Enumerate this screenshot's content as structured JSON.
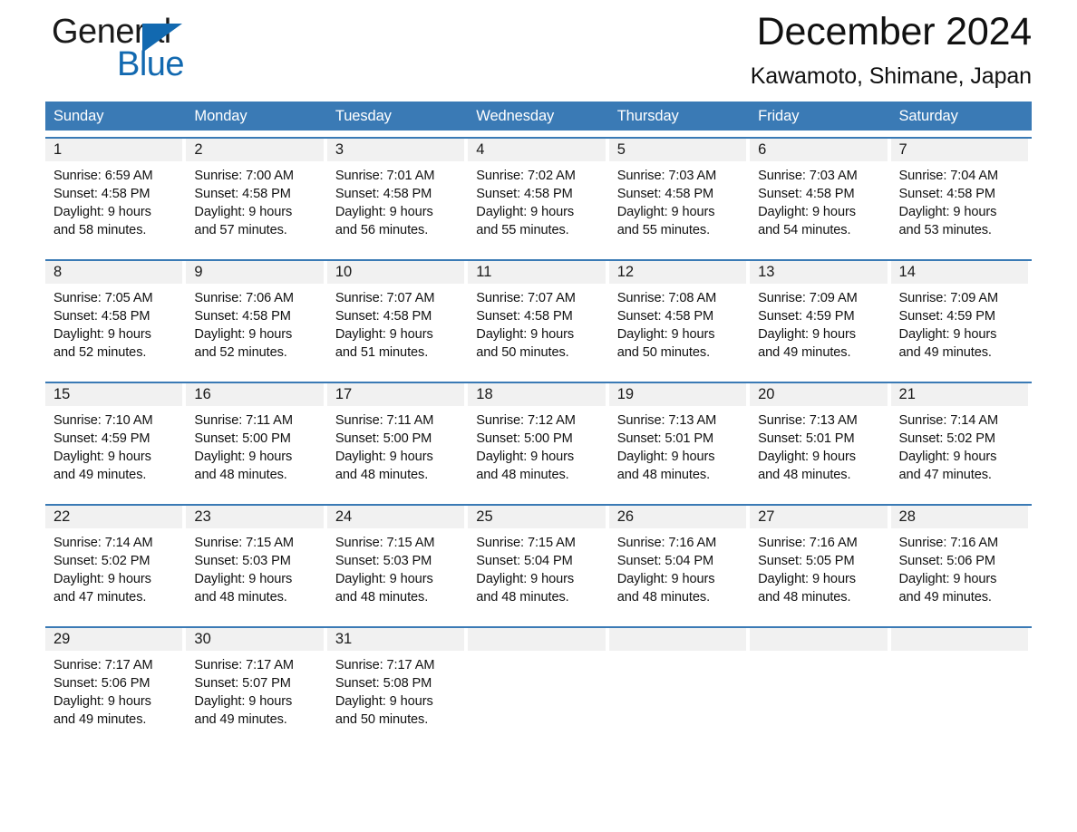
{
  "brand": {
    "word_one": "General",
    "word_two": "Blue",
    "triangle_icon": "triangle-icon",
    "accent_color": "#1269b0"
  },
  "header": {
    "title": "December 2024",
    "location": "Kawamoto, Shimane, Japan"
  },
  "theme": {
    "header_blue": "#3a7ab5",
    "daynum_strip": "#f1f1f1",
    "text": "#111111"
  },
  "weekdays": [
    "Sunday",
    "Monday",
    "Tuesday",
    "Wednesday",
    "Thursday",
    "Friday",
    "Saturday"
  ],
  "weeks": [
    [
      {
        "day": "1",
        "sunrise": "Sunrise: 6:59 AM",
        "sunset": "Sunset: 4:58 PM",
        "daylight1": "Daylight: 9 hours",
        "daylight2": "and 58 minutes."
      },
      {
        "day": "2",
        "sunrise": "Sunrise: 7:00 AM",
        "sunset": "Sunset: 4:58 PM",
        "daylight1": "Daylight: 9 hours",
        "daylight2": "and 57 minutes."
      },
      {
        "day": "3",
        "sunrise": "Sunrise: 7:01 AM",
        "sunset": "Sunset: 4:58 PM",
        "daylight1": "Daylight: 9 hours",
        "daylight2": "and 56 minutes."
      },
      {
        "day": "4",
        "sunrise": "Sunrise: 7:02 AM",
        "sunset": "Sunset: 4:58 PM",
        "daylight1": "Daylight: 9 hours",
        "daylight2": "and 55 minutes."
      },
      {
        "day": "5",
        "sunrise": "Sunrise: 7:03 AM",
        "sunset": "Sunset: 4:58 PM",
        "daylight1": "Daylight: 9 hours",
        "daylight2": "and 55 minutes."
      },
      {
        "day": "6",
        "sunrise": "Sunrise: 7:03 AM",
        "sunset": "Sunset: 4:58 PM",
        "daylight1": "Daylight: 9 hours",
        "daylight2": "and 54 minutes."
      },
      {
        "day": "7",
        "sunrise": "Sunrise: 7:04 AM",
        "sunset": "Sunset: 4:58 PM",
        "daylight1": "Daylight: 9 hours",
        "daylight2": "and 53 minutes."
      }
    ],
    [
      {
        "day": "8",
        "sunrise": "Sunrise: 7:05 AM",
        "sunset": "Sunset: 4:58 PM",
        "daylight1": "Daylight: 9 hours",
        "daylight2": "and 52 minutes."
      },
      {
        "day": "9",
        "sunrise": "Sunrise: 7:06 AM",
        "sunset": "Sunset: 4:58 PM",
        "daylight1": "Daylight: 9 hours",
        "daylight2": "and 52 minutes."
      },
      {
        "day": "10",
        "sunrise": "Sunrise: 7:07 AM",
        "sunset": "Sunset: 4:58 PM",
        "daylight1": "Daylight: 9 hours",
        "daylight2": "and 51 minutes."
      },
      {
        "day": "11",
        "sunrise": "Sunrise: 7:07 AM",
        "sunset": "Sunset: 4:58 PM",
        "daylight1": "Daylight: 9 hours",
        "daylight2": "and 50 minutes."
      },
      {
        "day": "12",
        "sunrise": "Sunrise: 7:08 AM",
        "sunset": "Sunset: 4:58 PM",
        "daylight1": "Daylight: 9 hours",
        "daylight2": "and 50 minutes."
      },
      {
        "day": "13",
        "sunrise": "Sunrise: 7:09 AM",
        "sunset": "Sunset: 4:59 PM",
        "daylight1": "Daylight: 9 hours",
        "daylight2": "and 49 minutes."
      },
      {
        "day": "14",
        "sunrise": "Sunrise: 7:09 AM",
        "sunset": "Sunset: 4:59 PM",
        "daylight1": "Daylight: 9 hours",
        "daylight2": "and 49 minutes."
      }
    ],
    [
      {
        "day": "15",
        "sunrise": "Sunrise: 7:10 AM",
        "sunset": "Sunset: 4:59 PM",
        "daylight1": "Daylight: 9 hours",
        "daylight2": "and 49 minutes."
      },
      {
        "day": "16",
        "sunrise": "Sunrise: 7:11 AM",
        "sunset": "Sunset: 5:00 PM",
        "daylight1": "Daylight: 9 hours",
        "daylight2": "and 48 minutes."
      },
      {
        "day": "17",
        "sunrise": "Sunrise: 7:11 AM",
        "sunset": "Sunset: 5:00 PM",
        "daylight1": "Daylight: 9 hours",
        "daylight2": "and 48 minutes."
      },
      {
        "day": "18",
        "sunrise": "Sunrise: 7:12 AM",
        "sunset": "Sunset: 5:00 PM",
        "daylight1": "Daylight: 9 hours",
        "daylight2": "and 48 minutes."
      },
      {
        "day": "19",
        "sunrise": "Sunrise: 7:13 AM",
        "sunset": "Sunset: 5:01 PM",
        "daylight1": "Daylight: 9 hours",
        "daylight2": "and 48 minutes."
      },
      {
        "day": "20",
        "sunrise": "Sunrise: 7:13 AM",
        "sunset": "Sunset: 5:01 PM",
        "daylight1": "Daylight: 9 hours",
        "daylight2": "and 48 minutes."
      },
      {
        "day": "21",
        "sunrise": "Sunrise: 7:14 AM",
        "sunset": "Sunset: 5:02 PM",
        "daylight1": "Daylight: 9 hours",
        "daylight2": "and 47 minutes."
      }
    ],
    [
      {
        "day": "22",
        "sunrise": "Sunrise: 7:14 AM",
        "sunset": "Sunset: 5:02 PM",
        "daylight1": "Daylight: 9 hours",
        "daylight2": "and 47 minutes."
      },
      {
        "day": "23",
        "sunrise": "Sunrise: 7:15 AM",
        "sunset": "Sunset: 5:03 PM",
        "daylight1": "Daylight: 9 hours",
        "daylight2": "and 48 minutes."
      },
      {
        "day": "24",
        "sunrise": "Sunrise: 7:15 AM",
        "sunset": "Sunset: 5:03 PM",
        "daylight1": "Daylight: 9 hours",
        "daylight2": "and 48 minutes."
      },
      {
        "day": "25",
        "sunrise": "Sunrise: 7:15 AM",
        "sunset": "Sunset: 5:04 PM",
        "daylight1": "Daylight: 9 hours",
        "daylight2": "and 48 minutes."
      },
      {
        "day": "26",
        "sunrise": "Sunrise: 7:16 AM",
        "sunset": "Sunset: 5:04 PM",
        "daylight1": "Daylight: 9 hours",
        "daylight2": "and 48 minutes."
      },
      {
        "day": "27",
        "sunrise": "Sunrise: 7:16 AM",
        "sunset": "Sunset: 5:05 PM",
        "daylight1": "Daylight: 9 hours",
        "daylight2": "and 48 minutes."
      },
      {
        "day": "28",
        "sunrise": "Sunrise: 7:16 AM",
        "sunset": "Sunset: 5:06 PM",
        "daylight1": "Daylight: 9 hours",
        "daylight2": "and 49 minutes."
      }
    ],
    [
      {
        "day": "29",
        "sunrise": "Sunrise: 7:17 AM",
        "sunset": "Sunset: 5:06 PM",
        "daylight1": "Daylight: 9 hours",
        "daylight2": "and 49 minutes."
      },
      {
        "day": "30",
        "sunrise": "Sunrise: 7:17 AM",
        "sunset": "Sunset: 5:07 PM",
        "daylight1": "Daylight: 9 hours",
        "daylight2": "and 49 minutes."
      },
      {
        "day": "31",
        "sunrise": "Sunrise: 7:17 AM",
        "sunset": "Sunset: 5:08 PM",
        "daylight1": "Daylight: 9 hours",
        "daylight2": "and 50 minutes."
      },
      {
        "day": "",
        "sunrise": "",
        "sunset": "",
        "daylight1": "",
        "daylight2": ""
      },
      {
        "day": "",
        "sunrise": "",
        "sunset": "",
        "daylight1": "",
        "daylight2": ""
      },
      {
        "day": "",
        "sunrise": "",
        "sunset": "",
        "daylight1": "",
        "daylight2": ""
      },
      {
        "day": "",
        "sunrise": "",
        "sunset": "",
        "daylight1": "",
        "daylight2": ""
      }
    ]
  ]
}
